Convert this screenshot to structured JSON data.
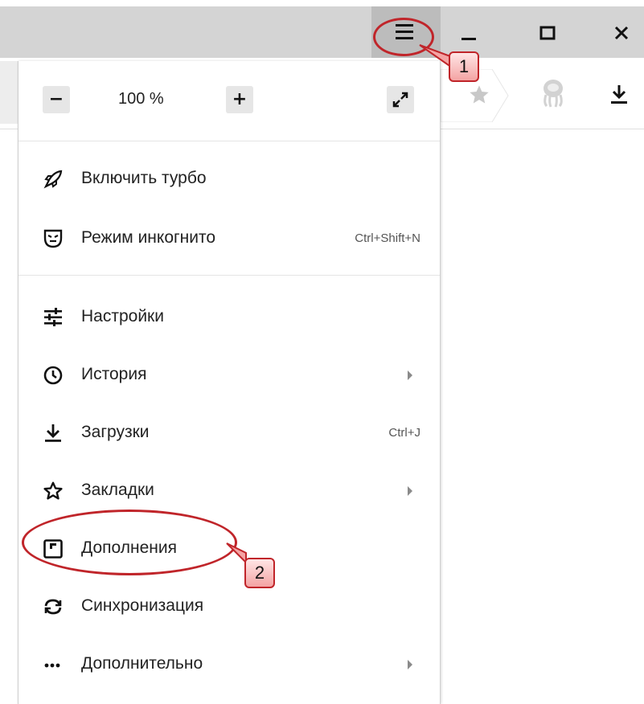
{
  "window": {
    "menu_icon": "hamburger-icon",
    "minimize_icon": "minimize-icon",
    "maximize_icon": "maximize-icon",
    "close_icon": "close-icon"
  },
  "toolbar": {
    "bookmark_icon": "star-icon",
    "extension_icon": "extension-icon",
    "downloads_icon": "download-icon"
  },
  "menu": {
    "zoom": {
      "minus_label": "−",
      "value": "100 %",
      "plus_label": "+",
      "fullscreen_icon": "fullscreen-icon"
    },
    "items": [
      {
        "label": "Включить турбо",
        "icon": "rocket-icon",
        "shortcut": "",
        "submenu": false
      },
      {
        "label": "Режим инкогнито",
        "icon": "incognito-mask-icon",
        "shortcut": "Ctrl+Shift+N",
        "submenu": false
      },
      {
        "label": "Настройки",
        "icon": "settings-sliders-icon",
        "shortcut": "",
        "submenu": false
      },
      {
        "label": "История",
        "icon": "clock-icon",
        "shortcut": "",
        "submenu": true
      },
      {
        "label": "Загрузки",
        "icon": "download-icon",
        "shortcut": "Ctrl+J",
        "submenu": false
      },
      {
        "label": "Закладки",
        "icon": "star-outline-icon",
        "shortcut": "",
        "submenu": true
      },
      {
        "label": "Дополнения",
        "icon": "addons-icon",
        "shortcut": "",
        "submenu": false
      },
      {
        "label": "Синхронизация",
        "icon": "sync-icon",
        "shortcut": "",
        "submenu": false
      },
      {
        "label": "Дополнительно",
        "icon": "more-dots-icon",
        "shortcut": "",
        "submenu": true
      }
    ]
  },
  "annotations": {
    "step1": "1",
    "step2": "2",
    "color": "#c0252a"
  }
}
